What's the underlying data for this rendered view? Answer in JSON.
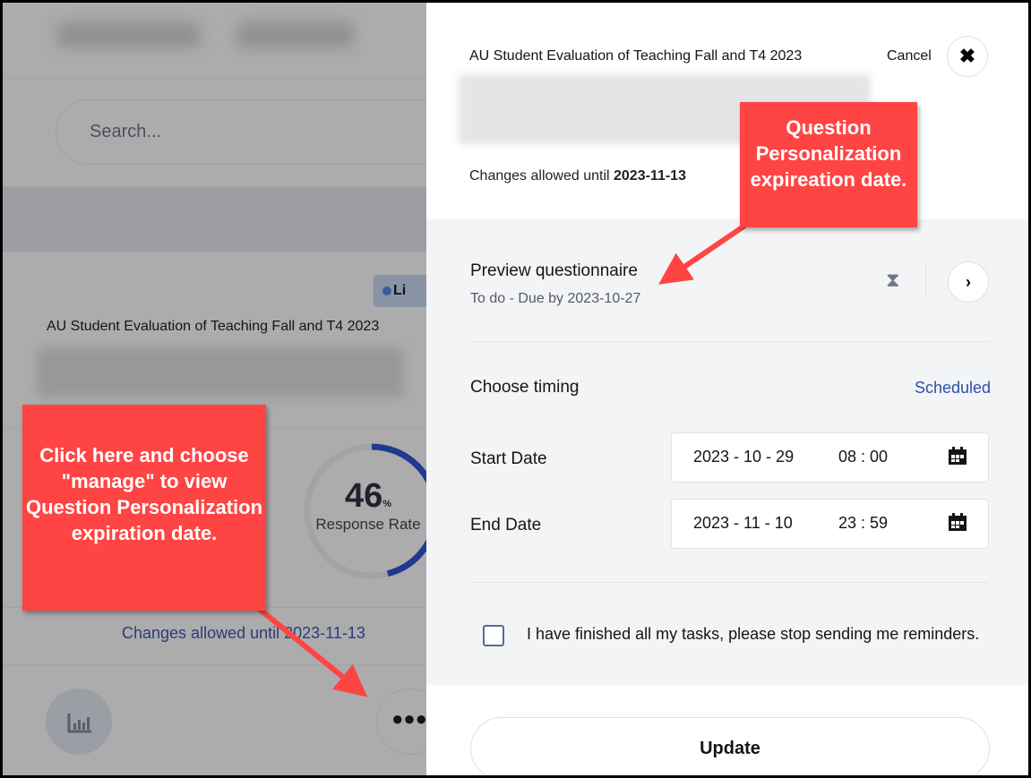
{
  "background": {
    "search_placeholder": "Search...",
    "status_badge": "Li",
    "survey_title": "AU Student Evaluation of Teaching Fall and T4 2023",
    "response_rate_value": "46",
    "response_rate_unit": "%",
    "response_rate_percent": 46,
    "response_rate_label": "Response Rate",
    "changes_allowed": "Changes allowed until 2023-11-13"
  },
  "panel": {
    "title": "AU Student Evaluation of Teaching Fall and T4 2023",
    "cancel_label": "Cancel",
    "changes_prefix": "Changes allowed until ",
    "changes_date": "2023-11-13",
    "preview": {
      "label": "Preview questionnaire",
      "status": "To do - Due by 2023-10-27"
    },
    "timing": {
      "label": "Choose timing",
      "value": "Scheduled"
    },
    "start": {
      "label": "Start Date",
      "date": "2023 - 10 - 29",
      "time": "08 : 00"
    },
    "end": {
      "label": "End Date",
      "date": "2023 - 11 - 10",
      "time": "23 : 59"
    },
    "reminder_label": "I have finished all my tasks, please stop sending me reminders.",
    "reminder_checked": false,
    "update_label": "Update"
  },
  "callouts": {
    "left": "Click here and choose \"manage\" to view Question Personalization expiration date.",
    "right": "Question Personalization expireation date."
  },
  "colors": {
    "callout": "#ff4444",
    "accent": "#2d4fa8",
    "ring": "#1f3a8f"
  }
}
